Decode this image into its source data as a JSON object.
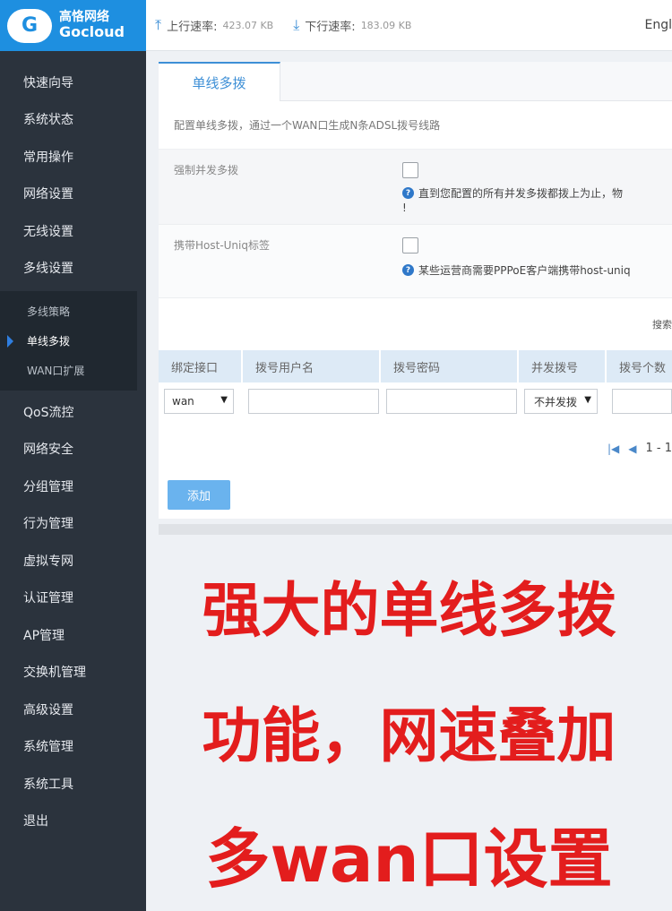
{
  "logo": {
    "badge": "G",
    "cn": "高恪网络",
    "en": "Gocloud"
  },
  "topbar": {
    "upload_label": "上行速率:",
    "upload_value": "423.07 KB",
    "download_label": "下行速率:",
    "download_value": "183.09 KB",
    "lang": "Engl"
  },
  "sidebar": {
    "items_top": [
      "快速向导",
      "系统状态",
      "常用操作",
      "网络设置",
      "无线设置",
      "多线设置"
    ],
    "sub_items": [
      "多线策略",
      "单线多拨",
      "WAN口扩展"
    ],
    "active_sub": "单线多拨",
    "items_bottom": [
      "QoS流控",
      "网络安全",
      "分组管理",
      "行为管理",
      "虚拟专网",
      "认证管理",
      "AP管理",
      "交换机管理",
      "高级设置",
      "系统管理",
      "系统工具",
      "退出"
    ]
  },
  "panel": {
    "tab": "单线多拨",
    "description": "配置单线多拨，通过一个WAN口生成N条ADSL拨号线路",
    "row1_label": "强制并发多拨",
    "row1_hint": "直到您配置的所有并发多拨都拨上为止，物",
    "row1_hint_tail": "!",
    "row2_label": "携带Host-Uniq标签",
    "row2_hint": "某些运营商需要PPPoE客户端携带host-uniq",
    "search": "搜索",
    "columns": [
      "绑定接口",
      "拨号用户名",
      "拨号密码",
      "并发拨号",
      "拨号个数"
    ],
    "row": {
      "interface": "wan",
      "concurrent": "不并发拨"
    },
    "pager": "1 - 1",
    "add_button": "添加"
  },
  "promo": {
    "line1": "强大的单线多拨",
    "line2": "功能，网速叠加",
    "line3": "多wan口设置"
  },
  "colors": {
    "sidebar_bg": "#2b333d",
    "logo_bg": "#1e8fe0",
    "accent": "#3d8fd6",
    "promo_red": "#e31d1d"
  }
}
